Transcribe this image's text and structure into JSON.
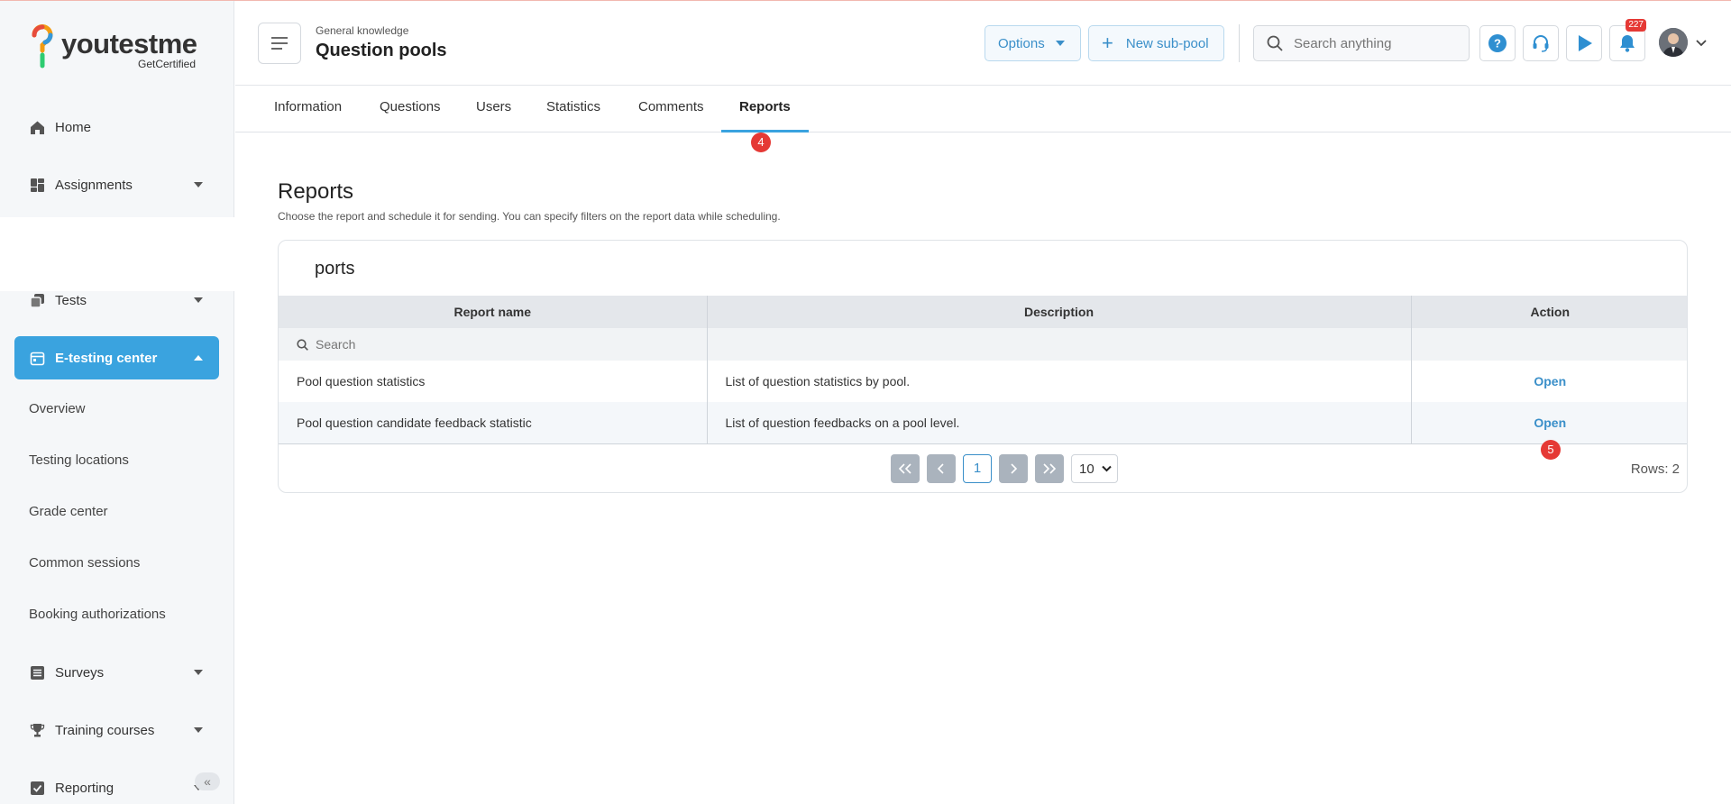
{
  "logo": {
    "brand": "youtestme",
    "sub": "GetCertified"
  },
  "sidebar": {
    "items": [
      {
        "label": "Home"
      },
      {
        "label": "Assignments"
      },
      {
        "label": "Tests"
      },
      {
        "label": "E-testing center"
      },
      {
        "label": "Surveys"
      },
      {
        "label": "Training courses"
      },
      {
        "label": "Reporting"
      }
    ],
    "sub_items": [
      {
        "label": "Overview"
      },
      {
        "label": "Testing locations"
      },
      {
        "label": "Grade center"
      },
      {
        "label": "Common sessions"
      },
      {
        "label": "Booking authorizations"
      }
    ],
    "collapse_glyph": "«"
  },
  "header": {
    "breadcrumb": "General knowledge",
    "title": "Question pools",
    "options_label": "Options",
    "new_subpool_label": "New sub-pool",
    "search_placeholder": "Search anything",
    "notifications_count": "227"
  },
  "tabs": [
    {
      "label": "Information"
    },
    {
      "label": "Questions"
    },
    {
      "label": "Users"
    },
    {
      "label": "Statistics"
    },
    {
      "label": "Comments"
    },
    {
      "label": "Reports"
    }
  ],
  "step_badges": {
    "tab": "4",
    "open": "5"
  },
  "reports": {
    "title": "Reports",
    "description": "Choose the report and schedule it for sending. You can specify filters on the report data while scheduling.",
    "card_title": "ports",
    "columns": [
      "Report name",
      "Description",
      "Action"
    ],
    "filter_placeholder": "Search",
    "rows": [
      {
        "name": "Pool question statistics",
        "description": "List of question statistics by pool.",
        "action": "Open"
      },
      {
        "name": "Pool question candidate feedback statistic",
        "description": "List of question feedbacks on a pool level.",
        "action": "Open"
      }
    ],
    "pagination": {
      "current_page": "1",
      "page_size": "10",
      "rows_label": "Rows: 2"
    }
  },
  "colors": {
    "accent": "#3aa3df",
    "link": "#3a8fc9",
    "badge": "#e53935"
  }
}
